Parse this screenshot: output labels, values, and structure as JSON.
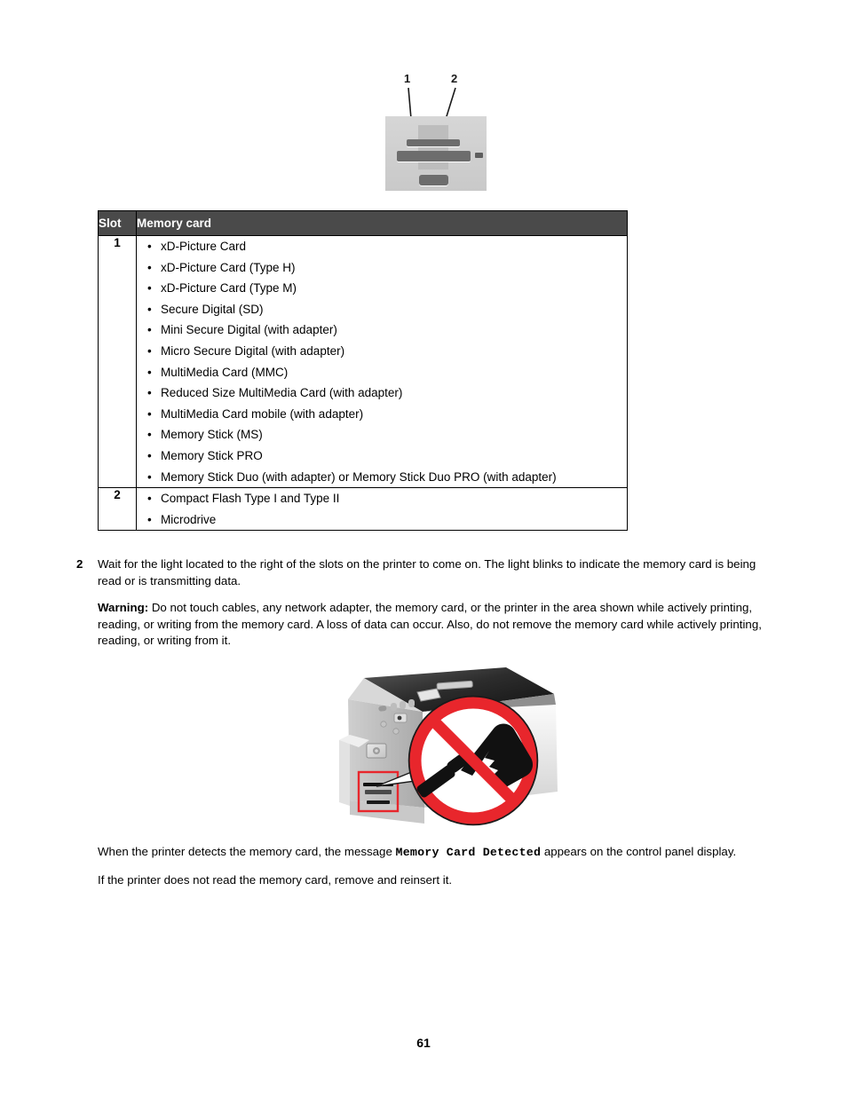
{
  "figure_slots": {
    "callouts": [
      {
        "label": "1"
      },
      {
        "label": "2"
      }
    ]
  },
  "table": {
    "headers": [
      "Slot",
      "Memory card"
    ],
    "rows": [
      {
        "slot": "1",
        "cards": [
          "xD-Picture Card",
          "xD-Picture Card (Type H)",
          "xD-Picture Card (Type M)",
          "Secure Digital (SD)",
          "Mini Secure Digital (with adapter)",
          "Micro Secure Digital (with adapter)",
          "MultiMedia Card (MMC)",
          "Reduced Size MultiMedia Card (with adapter)",
          "MultiMedia Card mobile (with adapter)",
          "Memory Stick (MS)",
          "Memory Stick PRO",
          "Memory Stick Duo (with adapter) or Memory Stick Duo PRO (with adapter)"
        ]
      },
      {
        "slot": "2",
        "cards": [
          "Compact Flash Type I and Type II",
          "Microdrive"
        ]
      }
    ]
  },
  "steps": {
    "step2": {
      "number": "2",
      "text": "Wait for the light located to the right of the slots on the printer to come on. The light blinks to indicate the memory card is being read or is transmitting data.",
      "warning_label": "Warning:",
      "warning_text": " Do not touch cables, any network adapter, the memory card, or the printer in the area shown while actively printing, reading, or writing from the memory card. A loss of data can occur. Also, do not remove the memory card while actively printing, reading, or writing from it."
    }
  },
  "closing": {
    "detected_before": "When the printer detects the memory card, the message ",
    "detected_message": "Memory Card Detected",
    "detected_after": " appears on the control panel display.",
    "reinsert": "If the printer does not read the memory card, remove and reinsert it."
  },
  "page_number": "61",
  "colors": {
    "table_header_bg": "#4a4a4a",
    "table_header_text": "#ffffff",
    "warning_red": "#e8262c",
    "slot_panel_gray": "#d2d2d2",
    "slot_dark_gray": "#6d6d6d"
  }
}
